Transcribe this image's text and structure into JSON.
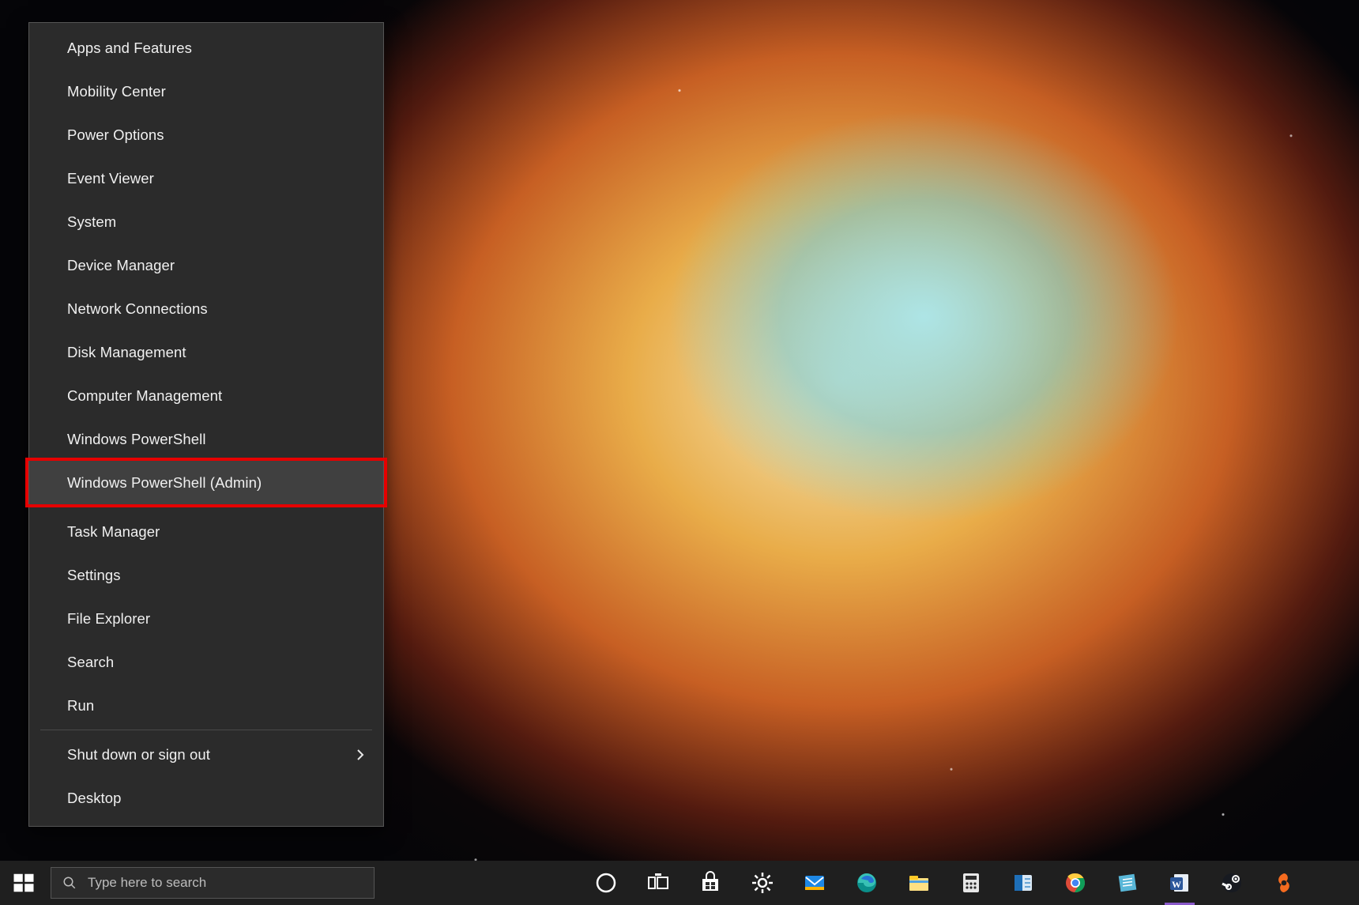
{
  "highlight": {
    "target_item_index": 10,
    "color": "#e60000"
  },
  "winx_menu": {
    "groups": [
      {
        "items": [
          {
            "id": "apps-features",
            "label": "Apps and Features",
            "submenu": false
          },
          {
            "id": "mobility-center",
            "label": "Mobility Center",
            "submenu": false
          },
          {
            "id": "power-options",
            "label": "Power Options",
            "submenu": false
          },
          {
            "id": "event-viewer",
            "label": "Event Viewer",
            "submenu": false
          },
          {
            "id": "system",
            "label": "System",
            "submenu": false
          },
          {
            "id": "device-manager",
            "label": "Device Manager",
            "submenu": false
          },
          {
            "id": "network-connections",
            "label": "Network Connections",
            "submenu": false
          },
          {
            "id": "disk-management",
            "label": "Disk Management",
            "submenu": false
          },
          {
            "id": "computer-management",
            "label": "Computer Management",
            "submenu": false
          },
          {
            "id": "powershell",
            "label": "Windows PowerShell",
            "submenu": false
          },
          {
            "id": "powershell-admin",
            "label": "Windows PowerShell (Admin)",
            "submenu": false,
            "hovered": true
          }
        ]
      },
      {
        "items": [
          {
            "id": "task-manager",
            "label": "Task Manager",
            "submenu": false
          },
          {
            "id": "settings",
            "label": "Settings",
            "submenu": false
          },
          {
            "id": "file-explorer",
            "label": "File Explorer",
            "submenu": false
          },
          {
            "id": "search",
            "label": "Search",
            "submenu": false
          },
          {
            "id": "run",
            "label": "Run",
            "submenu": false
          }
        ]
      },
      {
        "items": [
          {
            "id": "shutdown-signout",
            "label": "Shut down or sign out",
            "submenu": true
          },
          {
            "id": "desktop",
            "label": "Desktop",
            "submenu": false
          }
        ]
      }
    ]
  },
  "taskbar": {
    "search_placeholder": "Type here to search",
    "items": [
      {
        "id": "cortana",
        "name": "cortana-icon",
        "running": false
      },
      {
        "id": "task-view",
        "name": "task-view-icon",
        "running": false
      },
      {
        "id": "store",
        "name": "microsoft-store-icon",
        "running": false
      },
      {
        "id": "settings",
        "name": "settings-gear-icon",
        "running": false
      },
      {
        "id": "mail",
        "name": "mail-icon",
        "running": false
      },
      {
        "id": "edge",
        "name": "edge-icon",
        "running": false
      },
      {
        "id": "explorer",
        "name": "file-explorer-icon",
        "running": false
      },
      {
        "id": "calculator",
        "name": "calculator-icon",
        "running": false
      },
      {
        "id": "onenote",
        "name": "onenote-icon",
        "running": false
      },
      {
        "id": "chrome",
        "name": "chrome-icon",
        "running": false
      },
      {
        "id": "notes",
        "name": "sticky-notes-icon",
        "running": false
      },
      {
        "id": "word",
        "name": "word-icon",
        "running": true
      },
      {
        "id": "steam",
        "name": "steam-icon",
        "running": false
      },
      {
        "id": "origin",
        "name": "origin-icon",
        "running": false
      }
    ]
  }
}
